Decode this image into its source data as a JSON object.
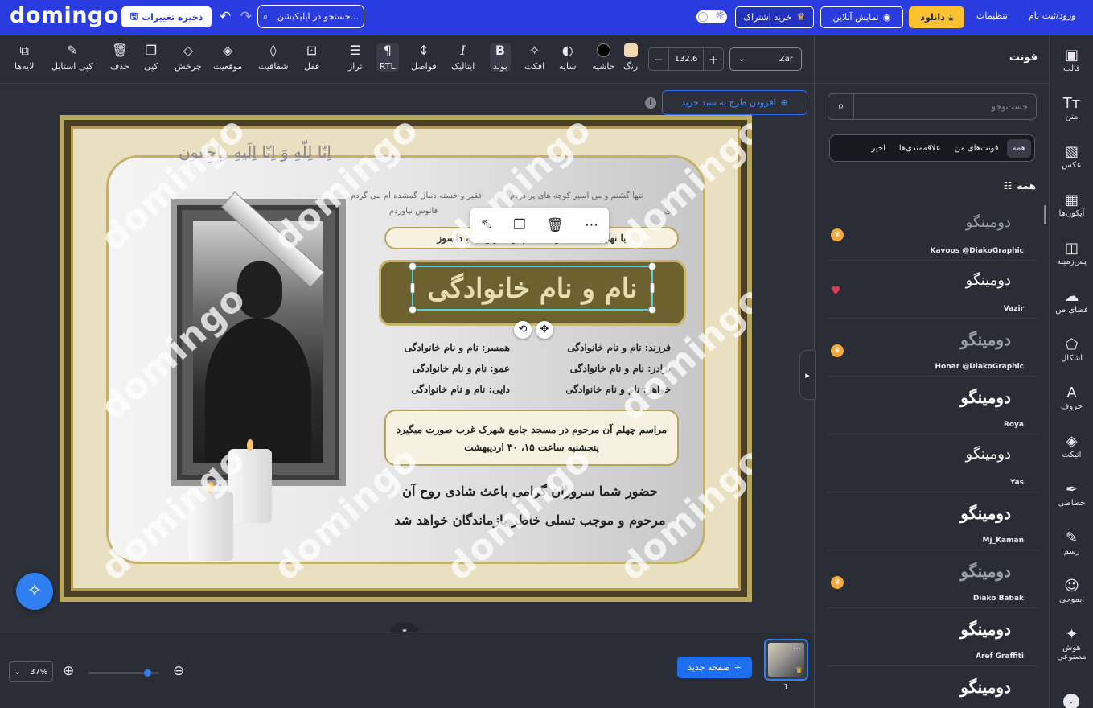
{
  "topbar": {
    "logo": "domingo",
    "save_label": "ذخیره تغییرات",
    "undo_icon": "↶",
    "redo_icon": "↷",
    "app_search": "جستجو در اپلیکیشن...",
    "subscribe_label": "خرید اشتراک",
    "preview_label": "نمایش آنلاین",
    "download_label": "دانلود",
    "settings_label": "تنظیمات",
    "login_label": "ورود/ثبت نام",
    "accent": "#2a3be0"
  },
  "toolbar": {
    "layers": "لایه‌ها",
    "copy_style": "کپی استایل",
    "delete": "حذف",
    "copy": "کپی",
    "rotate": "چرخش",
    "position": "موقعیت",
    "opacity": "شفافیت",
    "lock": "قفل",
    "align": "تراز",
    "rtl": "RTL",
    "spacing": "فواصل",
    "italic": "ایتالیک",
    "bold": "بولد",
    "effect": "افکت",
    "shadow": "سایه",
    "border": "حاشیه",
    "color": "رنگ",
    "font_size": "132.6",
    "font_name": "Zar"
  },
  "canvas": {
    "add_to_cart": "افزودن طرح به سبد خرید",
    "watermark": "domingo",
    "design": {
      "calligraphy": "اِنّا لِلّهِ وَ اِنّا اِلَیهِ راجِعون",
      "poem_line1_right": "تنها گشتم و من اسیر کوچه های پر دردم",
      "poem_line1_left": "فقیر و خسته دنبال گمشده ام می گردم",
      "poem_line2_right": "ای",
      "poem_line2_left": "فانوس     نیاوردم",
      "intro": "با نهایت تأسف درگذشت پدری مهربان و دلسوز",
      "name_title": "نام و نام خانوادگی",
      "son": "فرزند: نام و نام خانوادگی",
      "brother": "برادر: نام و نام خانوادگی",
      "sister": "خواهر: نام و نام خانوادگی",
      "spouse": "همسر: نام و نام خانوادگی",
      "uncle_paternal": "عمو: نام و نام خانوادگی",
      "uncle_maternal": "دایی: نام و نام خانوادگی",
      "ceremony_line1": "مراسم چهلم آن مرحوم در مسجد جامع شهرک غرب صورت میگیرد",
      "ceremony_line2": "پنجشنبه ساعت ۱۵، ۳۰ اردیبهشت",
      "closing_line1": "حضور شما سروران گرامی باعث شادی روح آن",
      "closing_line2": "مرحوم و موجب تسلی خاطر بازماندگان خواهد شد"
    }
  },
  "bottombar": {
    "zoom_label": "37%",
    "zoom_value": 0.37,
    "new_page_label": "صفحه جدید",
    "page_number": "1"
  },
  "font_panel": {
    "title": "فونت",
    "search_placeholder": "جست‌وجو",
    "tabs": [
      "همه",
      "فونت‌های من",
      "علاقه‌مندی‌ها",
      "اخیر"
    ],
    "active_tab": "همه",
    "list_heading": "همه",
    "fonts": [
      {
        "sample": "دومینگو",
        "name": "Kavoos @DiakoGraphic",
        "pro": true,
        "fav": false
      },
      {
        "sample": "دومینگو",
        "name": "Vazir",
        "pro": false,
        "fav": true
      },
      {
        "sample": "دومینگو",
        "name": "Honar @DiakoGraphic",
        "pro": true,
        "fav": false
      },
      {
        "sample": "دومینگو",
        "name": "Roya",
        "pro": false,
        "fav": false
      },
      {
        "sample": "دومینگو",
        "name": "Yas",
        "pro": false,
        "fav": false
      },
      {
        "sample": "دومینگو",
        "name": "Mj_Kaman",
        "pro": false,
        "fav": false
      },
      {
        "sample": "دومینگو",
        "name": "Diako Babak",
        "pro": true,
        "fav": false
      },
      {
        "sample": "دومینگو",
        "name": "Aref Graffiti",
        "pro": false,
        "fav": false
      },
      {
        "sample": "دومینگو",
        "name": "",
        "pro": false,
        "fav": false
      }
    ]
  },
  "sidebar": {
    "items": [
      "قالب",
      "متن",
      "عکس",
      "آیکون‌ها",
      "پس‌زمینه",
      "فضای من",
      "اشکال",
      "حروف",
      "اتیکت",
      "خطاطی",
      "رسم",
      "ایموجی",
      "هوش مصنوعی"
    ]
  }
}
